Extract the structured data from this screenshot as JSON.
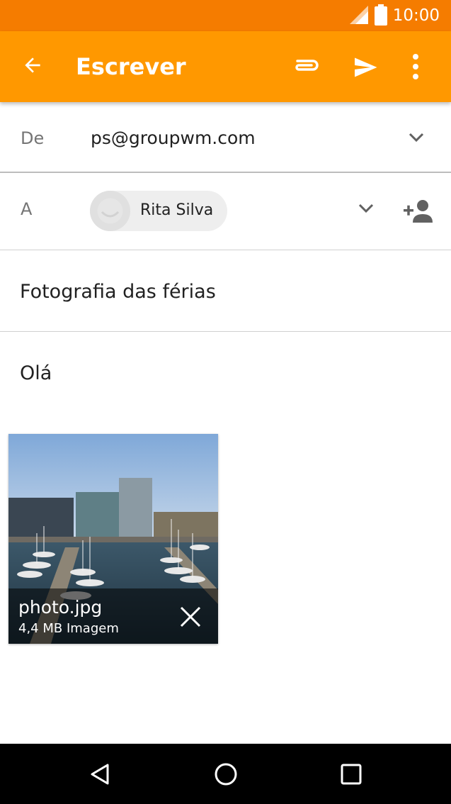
{
  "status_bar": {
    "time": "10:00",
    "signal_icon": "signal-icon",
    "battery_icon": "battery-icon"
  },
  "app_bar": {
    "title": "Escrever",
    "back_icon": "arrow-back-icon",
    "attach_icon": "paperclip-icon",
    "send_icon": "send-icon",
    "more_icon": "more-vert-icon",
    "color": "#ff9800"
  },
  "compose": {
    "from_label": "De",
    "from_value": "ps@groupwm.com",
    "to_label": "A",
    "to_chip_name": "Rita Silva",
    "subject": "Fotografia das férias",
    "body": "Olá"
  },
  "attachment": {
    "filename": "photo.jpg",
    "details": "4,4 MB Imagem"
  },
  "nav_bar": {
    "back_icon": "nav-back-icon",
    "home_icon": "nav-home-icon",
    "recents_icon": "nav-recents-icon"
  }
}
